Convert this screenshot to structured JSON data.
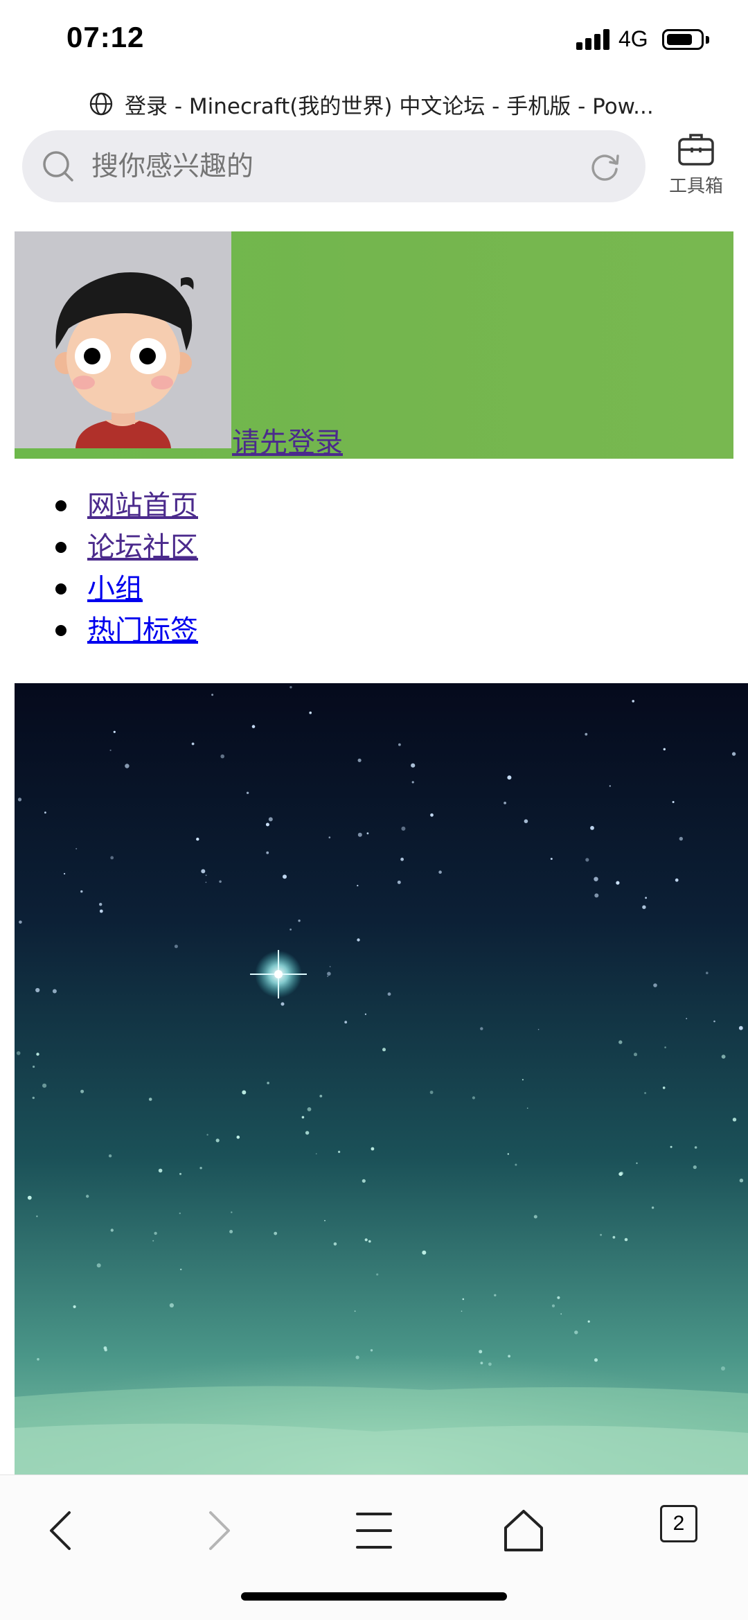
{
  "status_bar": {
    "time": "07:12",
    "network": "4G",
    "battery_level": 0.75
  },
  "browser": {
    "page_title": "登录 - Minecraft(我的世界) 中文论坛 - 手机版 - Pow...",
    "search_placeholder": "搜你感兴趣的",
    "toolbox_label": "工具箱",
    "tab_count": "2"
  },
  "banner": {
    "login_link": "请先登录",
    "background_color": "#74b64e"
  },
  "nav": {
    "items": [
      {
        "label": "网站首页"
      },
      {
        "label": "论坛社区"
      },
      {
        "label": "小组"
      },
      {
        "label": "热门标签"
      }
    ]
  },
  "toolbar": {
    "icons": [
      "back-icon",
      "forward-icon",
      "menu-icon",
      "home-icon",
      "tabs-icon"
    ]
  }
}
